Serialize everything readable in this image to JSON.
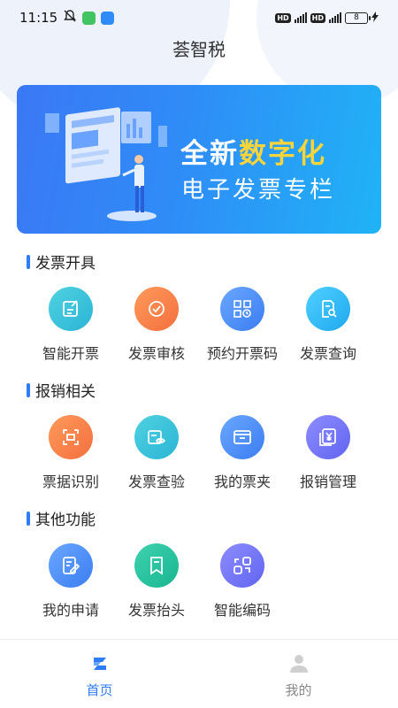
{
  "status_bar": {
    "time": "11:15",
    "battery": "8"
  },
  "app_title": "荟智税",
  "banner": {
    "line1_plain": "全新",
    "line1_highlight": "数字化",
    "line2": "电子发票专栏"
  },
  "colors": {
    "accent": "#2f7cf6",
    "highlight": "#f9d43a",
    "active_tab": "#2f7cf6",
    "inactive_tab": "#888888"
  },
  "sections": [
    {
      "title": "发票开具",
      "items": [
        {
          "label": "智能开票",
          "icon": "edit-icon"
        },
        {
          "label": "发票审核",
          "icon": "check-circle-icon"
        },
        {
          "label": "预约开票码",
          "icon": "qr-calendar-icon"
        },
        {
          "label": "发票查询",
          "icon": "doc-search-icon"
        }
      ]
    },
    {
      "title": "报销相关",
      "items": [
        {
          "label": "票据识别",
          "icon": "scan-icon"
        },
        {
          "label": "发票查验",
          "icon": "verify-eye-icon"
        },
        {
          "label": "我的票夹",
          "icon": "folder-icon"
        },
        {
          "label": "报销管理",
          "icon": "yen-docs-icon"
        }
      ]
    },
    {
      "title": "其他功能",
      "items": [
        {
          "label": "我的申请",
          "icon": "doc-pen-icon"
        },
        {
          "label": "发票抬头",
          "icon": "bookmark-icon"
        },
        {
          "label": "智能编码",
          "icon": "link-code-icon"
        }
      ]
    }
  ],
  "tabs": [
    {
      "label": "首页",
      "icon": "home-logo-icon",
      "active": true
    },
    {
      "label": "我的",
      "icon": "user-icon",
      "active": false
    }
  ]
}
